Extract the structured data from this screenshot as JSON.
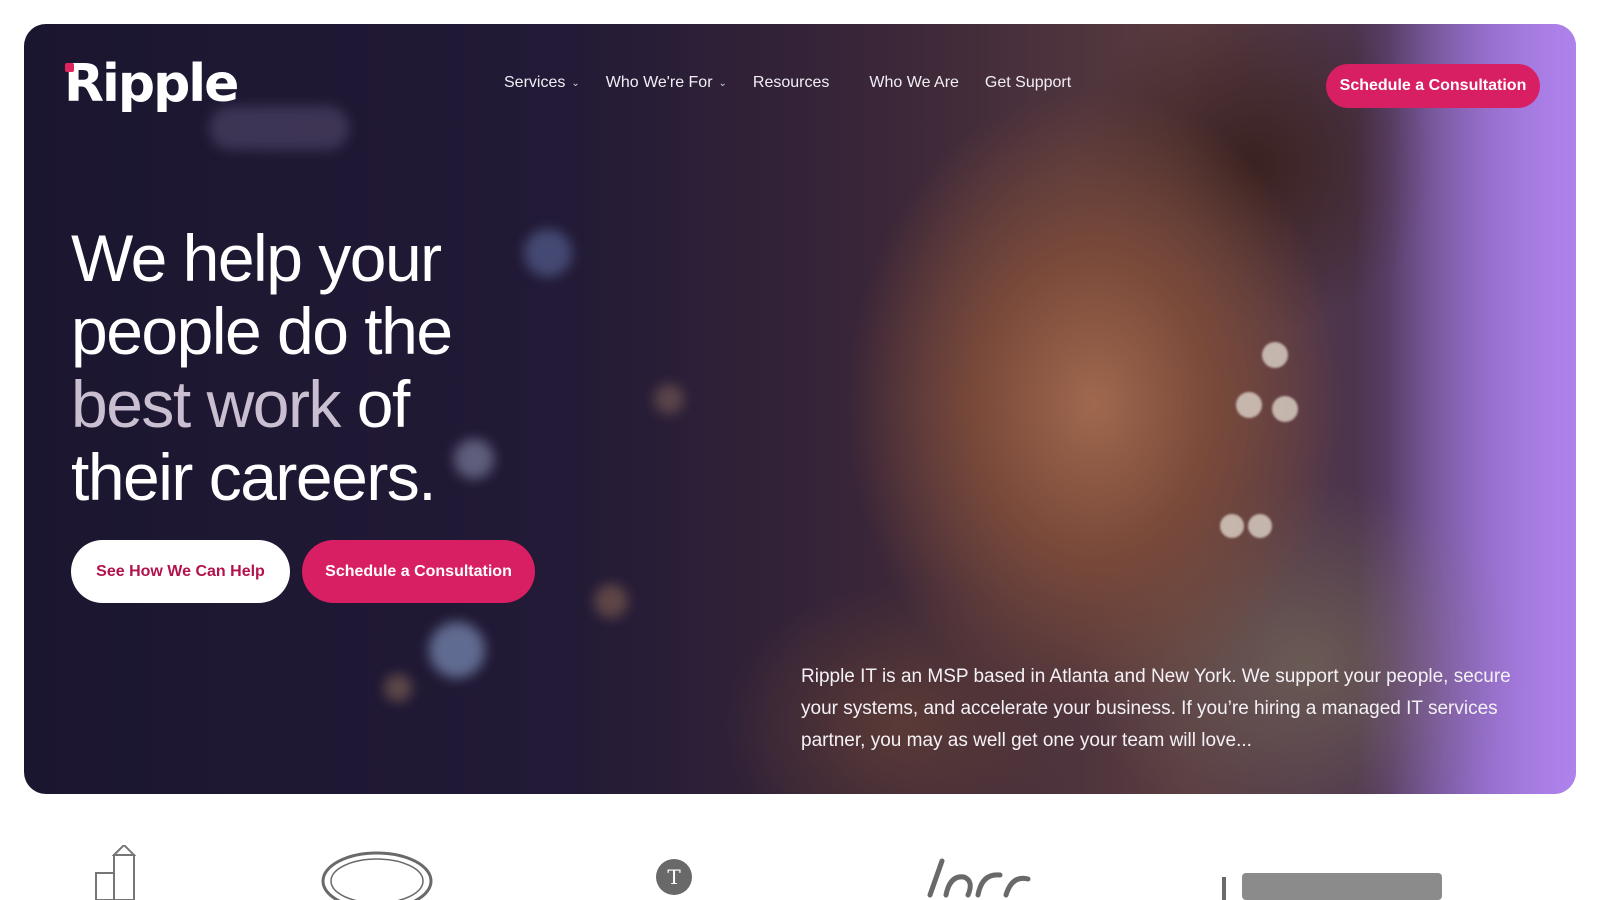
{
  "brand": {
    "logo_text": "Ripple",
    "accent_color": "#d91f63"
  },
  "nav": {
    "items": [
      {
        "label": "Services",
        "has_dropdown": true
      },
      {
        "label": "Who We're For",
        "has_dropdown": true
      },
      {
        "label": "Resources",
        "has_dropdown": false
      },
      {
        "label": "Who We Are",
        "has_dropdown": false
      },
      {
        "label": "Get Support",
        "has_dropdown": false
      }
    ],
    "cta_label": "Schedule a Consultation"
  },
  "hero": {
    "headline_line1": "We help your",
    "headline_line2": "people do the",
    "headline_muted": "best work",
    "headline_line3_rest": "of",
    "headline_line4": "their careers.",
    "primary_button": "See How We Can Help",
    "secondary_button": "Schedule a Consultation",
    "blurb": "Ripple IT is an MSP based in Atlanta and New York. We support your people, secure your systems, and accelerate your business. If you’re hiring a managed IT services partner, you may as well get one your team will love..."
  },
  "client_logos": {
    "items": [
      {
        "icon": "building-logo-icon"
      },
      {
        "icon": "sunburst-logo-icon"
      },
      {
        "icon": "circle-logo-icon"
      },
      {
        "icon": "script-logo-icon"
      },
      {
        "icon": "wordmark-logo-icon"
      }
    ]
  }
}
